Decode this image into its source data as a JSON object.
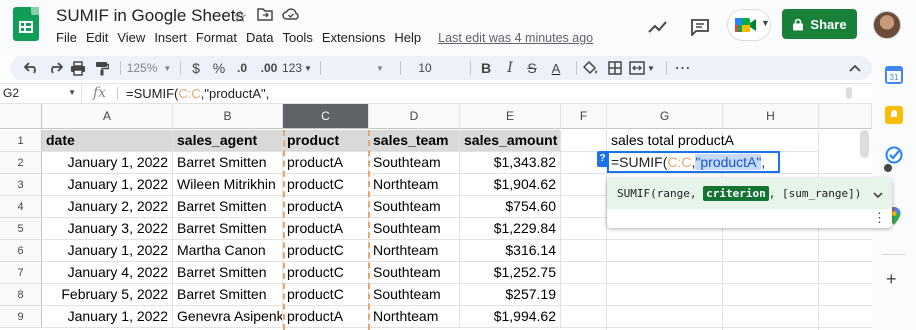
{
  "app": {
    "title": "SUMIF in Google Sheets",
    "last_edit": "Last edit was 4 minutes ago",
    "share_label": "Share",
    "accent_green": "#188038"
  },
  "menu": [
    "File",
    "Edit",
    "View",
    "Insert",
    "Format",
    "Data",
    "Tools",
    "Extensions",
    "Help"
  ],
  "toolbar": {
    "zoom": "125%",
    "currency": "$",
    "percent": "%",
    "decrease_decimal": ".0",
    "increase_decimal": ".00",
    "more_formats": "123",
    "font_size": "10"
  },
  "formula_bar": {
    "name_box": "G2",
    "fx_label": "fx",
    "formula_prefix": "=SUMIF(",
    "formula_range": "C:C",
    "formula_suffix": ",\"productA\","
  },
  "columns": [
    "A",
    "B",
    "C",
    "D",
    "E",
    "F",
    "G",
    "H"
  ],
  "rows": [
    "1",
    "2",
    "3",
    "4",
    "5",
    "6",
    "7",
    "8",
    "9"
  ],
  "table": {
    "headers": [
      "date",
      "sales_agent",
      "product",
      "sales_team",
      "sales_amount"
    ],
    "data": [
      [
        "January 1, 2022",
        "Barret Smitten",
        "productA",
        "Southteam",
        "$1,343.82"
      ],
      [
        "January 1, 2022",
        "Wileen Mitrikhin",
        "productC",
        "Northteam",
        "$1,904.62"
      ],
      [
        "January 2, 2022",
        "Barret Smitten",
        "productA",
        "Southteam",
        "$754.60"
      ],
      [
        "January 3, 2022",
        "Barret Smitten",
        "productA",
        "Southteam",
        "$1,229.84"
      ],
      [
        "January 1, 2022",
        "Martha Canon",
        "productC",
        "Northteam",
        "$316.14"
      ],
      [
        "January 4, 2022",
        "Barret Smitten",
        "productC",
        "Southteam",
        "$1,252.75"
      ],
      [
        "February 5, 2022",
        "Barret Smitten",
        "productC",
        "Southteam",
        "$257.19"
      ],
      [
        "January 1, 2022",
        "Genevra Asipenko",
        "productA",
        "Northteam",
        "$1,994.62"
      ]
    ]
  },
  "g1_label": "sales total productA",
  "edit_cell": {
    "help_badge": "?",
    "prefix": "=SUMIF(",
    "range": "C:C",
    "comma": ",",
    "criterion": "\"productA\"",
    "suffix": ","
  },
  "tooltip": {
    "fn": "SUMIF(range, ",
    "active_arg": "criterion",
    "rest": ", [sum_range])"
  }
}
